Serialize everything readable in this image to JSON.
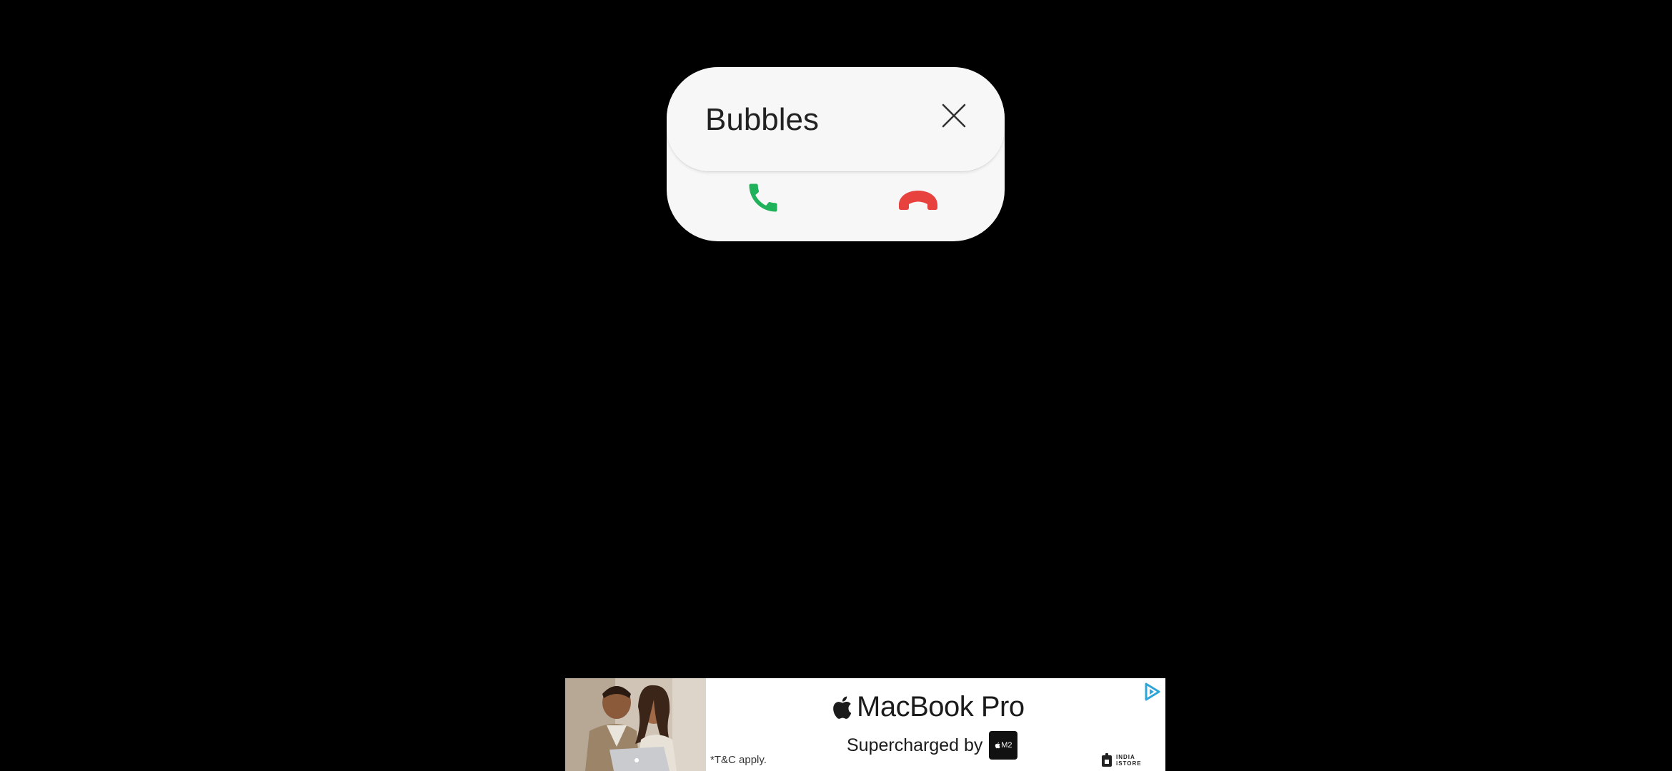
{
  "call_popup": {
    "title": "Bubbles",
    "close_icon": "close-icon",
    "accept_icon": "phone-accept-icon",
    "decline_icon": "phone-decline-icon",
    "accept_color": "#1fb25a",
    "decline_color": "#e8423f",
    "background": "#f7f7f7"
  },
  "ad": {
    "product_name": "MacBook Pro",
    "tagline": "Supercharged by",
    "chip_label": "M2",
    "terms": "*T&C apply.",
    "store_name_line1": "INDIA",
    "store_name_line2": "iSTORE",
    "adchoices_icon": "adchoices-icon",
    "adchoices_color": "#2fa6d9"
  }
}
